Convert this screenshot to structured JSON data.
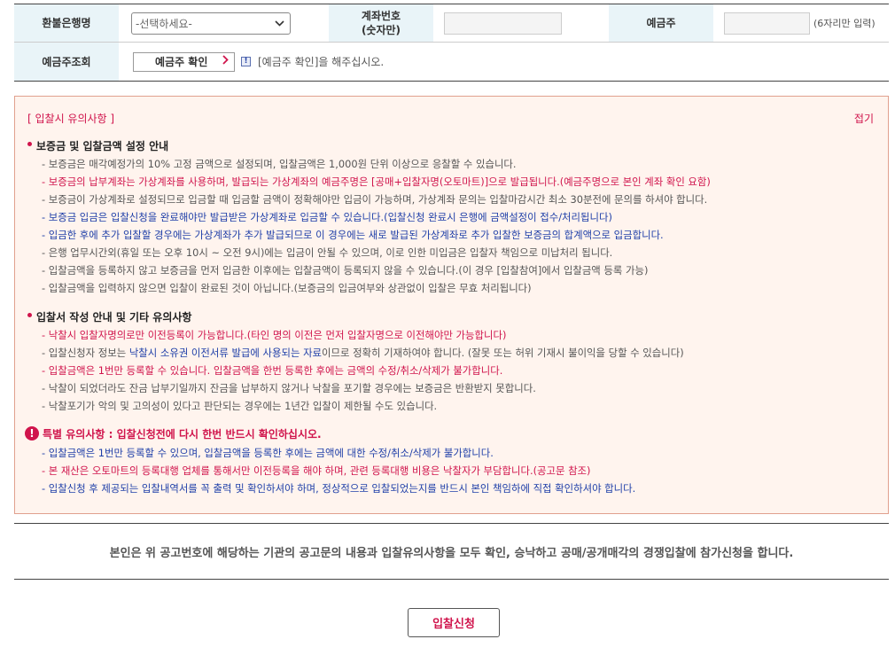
{
  "form": {
    "refund_bank_label": "환불은행명",
    "bank_select_value": "-선택하세요-",
    "account_label_line1": "계좌번호",
    "account_label_line2": "(숫자만)",
    "account_value": "",
    "holder_label": "예금주",
    "holder_value": "",
    "holder_hint": "(6자리만 입력)",
    "holder_check_label": "예금주조회",
    "confirm_button": "예금주 확인",
    "confirm_message": "[예금주 확인]을 해주십시오."
  },
  "notice": {
    "title": "[ 입찰시 유의사항 ]",
    "fold_label": "접기",
    "section1": {
      "title": "보증금 및 입찰금액 설정 안내",
      "items": [
        "- 보증금은 매각예정가의 10% 고정 금액으로 설정되며, 입찰금액은 1,000원 단위 이상으로 응찰할 수 있습니다.",
        "- 보증금의 납부계좌는 가상계좌를 사용하며, 발급되는 가상계좌의 예금주명은 [공매+입찰자명(오토마트)]으로 발급됩니다.(예금주명으로 본인 계좌 확인 요함)",
        "- 보증금이 가상계좌로 설정되므로 입금할 때 입금할 금액이 정확해야만 입금이 가능하며, 가상계좌 문의는 입찰마감시간 최소 30분전에 문의를 하셔야 합니다.",
        "- 보증금 입금은 입찰신청을 완료해야만 발급받은 가상계좌로 입금할 수 있습니다.(입찰신청 완료시 은행에 금액설정이 접수/처리됩니다)",
        "- 입금한 후에 추가 입찰할 경우에는 가상계좌가 추가 발급되므로 이 경우에는 새로 발급된 가상계좌로 추가 입찰한 보증금의 합계액으로 입금합니다.",
        "- 은행 업무시간외(휴일 또는 오후 10시 ~ 오전 9시)에는 입금이 안될 수 있으며, 이로 인한 미입금은 입찰자 책임으로 미납처리 됩니다.",
        "- 입찰금액을 등록하지 않고 보증금을 먼저 입금한 이후에는 입찰금액이 등록되지 않을 수 있습니다.(이 경우 [입찰참여]에서 입찰금액 등록 가능)",
        "- 입찰금액을 입력하지 않으면 입찰이 완료된 것이 아닙니다.(보증금의 입금여부와 상관없이 입찰은 무효 처리됩니다)"
      ]
    },
    "section2": {
      "title": "입찰서 작성 안내 및 기타 유의사항",
      "item1": "- 낙찰시 입찰자명의로만 이전등록이 가능합니다.(타인 명의 이전은 먼저 입찰자명으로 이전해야만 가능합니다)",
      "item2_a": "- 입찰신청자 정보는 ",
      "item2_b": "낙찰시 소유권 이전서류 발급에 사용되는 자료",
      "item2_c": "이므로 정확히 기재하여야 합니다. (잘못 또는 허위 기재시 불이익을 당할 수 있습니다)",
      "item3": "- 입찰금액은 1번만 등록할 수 있습니다. 입찰금액을 한번 등록한 후에는 금액의 수정/취소/삭제가 불가합니다.",
      "item4": "- 낙찰이 되었더라도 잔금 납부기일까지 잔금을 납부하지 않거나 낙찰을 포기할 경우에는 보증금은 반환받지 못합니다.",
      "item5": "- 낙찰포기가 악의 및 고의성이 있다고 판단되는 경우에는 1년간 입찰이 제한될 수도 있습니다."
    },
    "section3": {
      "title": "특별 유의사항 : 입찰신청전에 다시 한번 반드시 확인하십시오.",
      "items": [
        "- 입찰금액은 1번만 등록할 수 있으며, 입찰금액을 등록한 후에는 금액에 대한 수정/취소/삭제가 불가합니다.",
        "- 본 재산은 오토마트의 등록대행 업체를 통해서만 이전등록을 해야 하며, 관련 등록대행 비용은 낙찰자가 부담합니다.(공고문 참조)",
        "- 입찰신청 후 제공되는 입찰내역서를 꼭 출력 및 확인하셔야 하며, 정상적으로 입찰되었는지를 반드시 본인 책임하에 직접 확인하셔야 합니다."
      ]
    }
  },
  "agreement": "본인은 위 공고번호에 해당하는 기관의 공고문의 내용과 입찰유의사항을 모두 확인, 승낙하고 공매/공개매각의 경쟁입찰에 참가신청을 합니다.",
  "submit_button": "입찰신청",
  "colors": {
    "accent": "#d0144c",
    "blue": "#1f3fa8",
    "header_bg": "#e9f4f8",
    "notice_bg": "#fff4ee"
  },
  "icons": {
    "select_chevron": "chevron-down-icon",
    "confirm_arrow": "chevron-right-icon",
    "info": "info-icon",
    "warning": "exclamation-circle-icon"
  }
}
